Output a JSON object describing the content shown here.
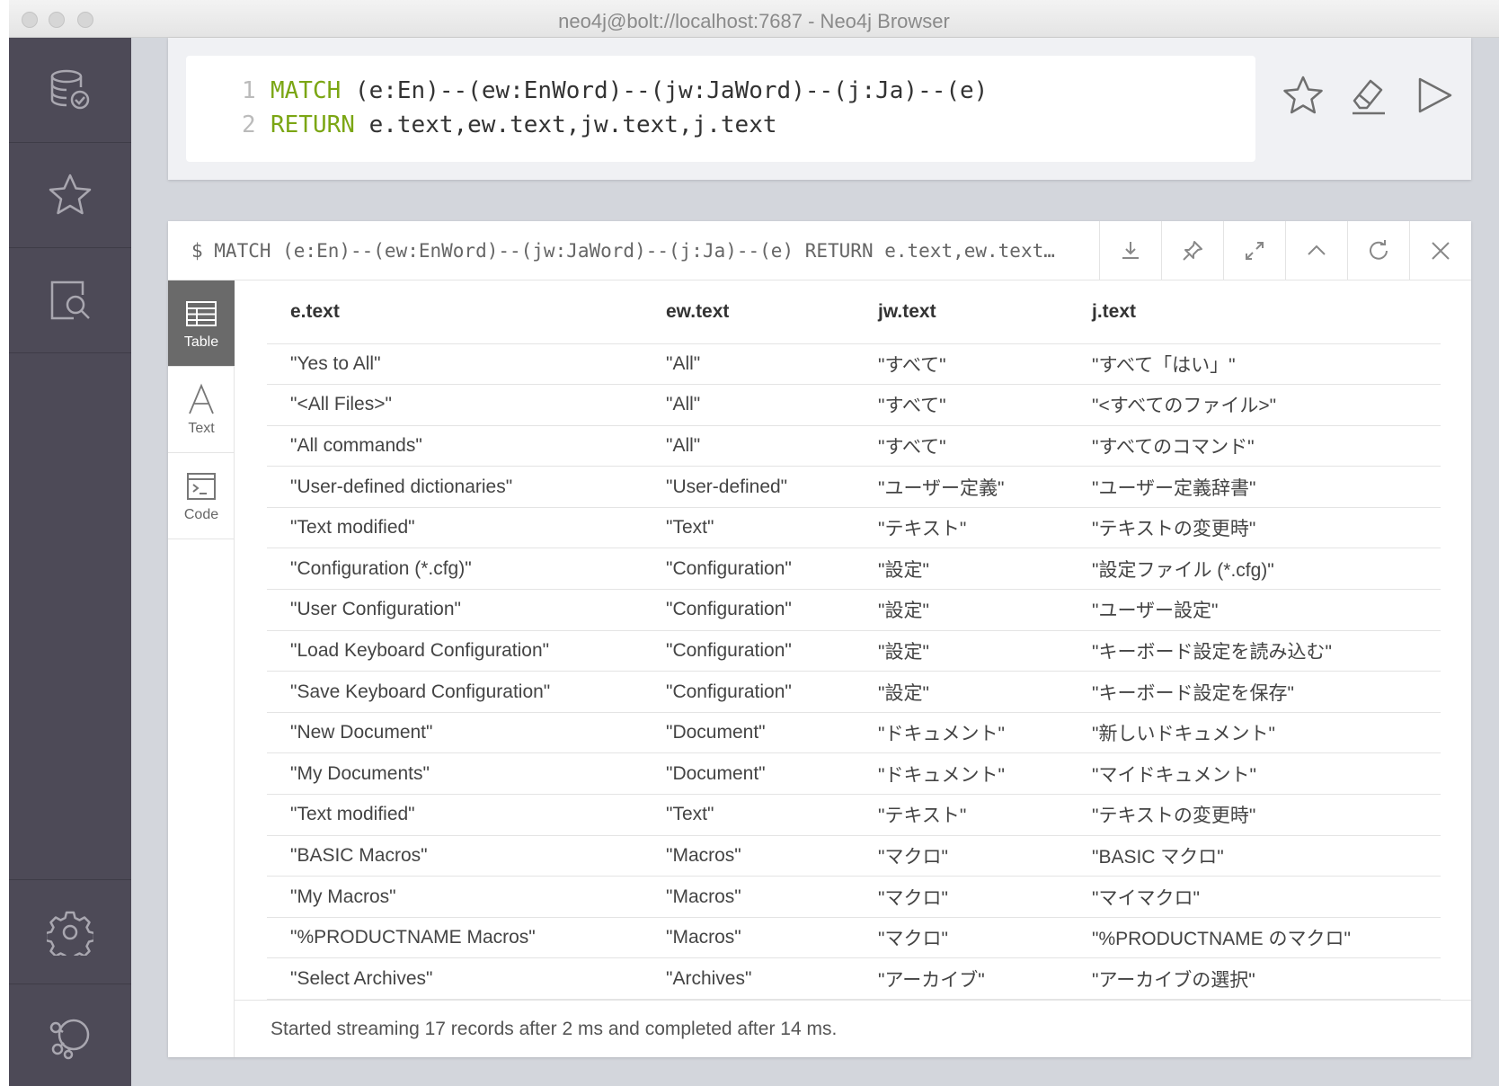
{
  "window": {
    "title": "neo4j@bolt://localhost:7687 - Neo4j Browser"
  },
  "sidebar": {
    "items": [
      {
        "icon": "database-icon"
      },
      {
        "icon": "star-icon"
      },
      {
        "icon": "document-search-icon"
      },
      {
        "icon": "gear-icon"
      },
      {
        "icon": "neo4j-logo-icon"
      }
    ]
  },
  "editor": {
    "lines": [
      {
        "no": "1",
        "keyword": "MATCH",
        "rest": " (e:En)--(ew:EnWord)--(jw:JaWord)--(j:Ja)--(e)"
      },
      {
        "no": "2",
        "keyword": "RETURN",
        "rest": " e.text,ew.text,jw.text,j.text"
      }
    ],
    "buttons": [
      "favorite",
      "clear",
      "run"
    ]
  },
  "result": {
    "query": "$ MATCH (e:En)--(ew:EnWord)--(jw:JaWord)--(j:Ja)--(e) RETURN e.text,ew.text…",
    "view_tabs": [
      {
        "label": "Table",
        "icon": "table-icon",
        "active": true
      },
      {
        "label": "Text",
        "icon": "text-icon",
        "active": false
      },
      {
        "label": "Code",
        "icon": "code-icon",
        "active": false
      }
    ],
    "columns": [
      "e.text",
      "ew.text",
      "jw.text",
      "j.text"
    ],
    "rows": [
      [
        "\"Yes to All\"",
        "\"All\"",
        "\"すべて\"",
        "\"すべて「はい」\""
      ],
      [
        "\"<All Files>\"",
        "\"All\"",
        "\"すべて\"",
        "\"<すべてのファイル>\""
      ],
      [
        "\"All commands\"",
        "\"All\"",
        "\"すべて\"",
        "\"すべてのコマンド\""
      ],
      [
        "\"User-defined dictionaries\"",
        "\"User-defined\"",
        "\"ユーザー定義\"",
        "\"ユーザー定義辞書\""
      ],
      [
        "\"Text modified\"",
        "\"Text\"",
        "\"テキスト\"",
        "\"テキストの変更時\""
      ],
      [
        "\"Configuration (*.cfg)\"",
        "\"Configuration\"",
        "\"設定\"",
        "\"設定ファイル (*.cfg)\""
      ],
      [
        "\"User Configuration\"",
        "\"Configuration\"",
        "\"設定\"",
        "\"ユーザー設定\""
      ],
      [
        "\"Load Keyboard Configuration\"",
        "\"Configuration\"",
        "\"設定\"",
        "\"キーボード設定を読み込む\""
      ],
      [
        "\"Save Keyboard Configuration\"",
        "\"Configuration\"",
        "\"設定\"",
        "\"キーボード設定を保存\""
      ],
      [
        "\"New Document\"",
        "\"Document\"",
        "\"ドキュメント\"",
        "\"新しいドキュメント\""
      ],
      [
        "\"My Documents\"",
        "\"Document\"",
        "\"ドキュメント\"",
        "\"マイドキュメント\""
      ],
      [
        "\"Text modified\"",
        "\"Text\"",
        "\"テキスト\"",
        "\"テキストの変更時\""
      ],
      [
        "\"BASIC Macros\"",
        "\"Macros\"",
        "\"マクロ\"",
        "\"BASIC マクロ\""
      ],
      [
        "\"My Macros\"",
        "\"Macros\"",
        "\"マクロ\"",
        "\"マイマクロ\""
      ],
      [
        "\"%PRODUCTNAME Macros\"",
        "\"Macros\"",
        "\"マクロ\"",
        "\"%PRODUCTNAME のマクロ\""
      ],
      [
        "\"Select Archives\"",
        "\"Archives\"",
        "\"アーカイブ\"",
        "\"アーカイブの選択\""
      ]
    ],
    "status": "Started streaming 17 records after 2 ms and completed after 14 ms."
  }
}
